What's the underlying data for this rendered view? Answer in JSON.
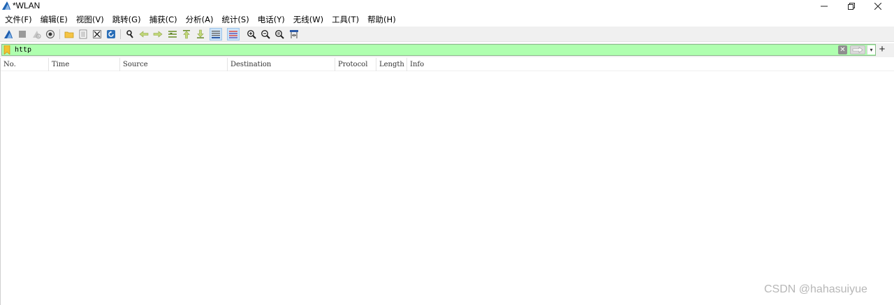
{
  "window": {
    "title": "*WLAN",
    "controls": {
      "minimize": "—",
      "maximize": "❐",
      "close": "✕"
    }
  },
  "menu": {
    "items": [
      "文件(F)",
      "编辑(E)",
      "视图(V)",
      "跳转(G)",
      "捕获(C)",
      "分析(A)",
      "统计(S)",
      "电话(Y)",
      "无线(W)",
      "工具(T)",
      "帮助(H)"
    ]
  },
  "toolbar": {
    "buttons": [
      {
        "icon": "shark-fin-start-icon",
        "active": false
      },
      {
        "icon": "stop-capture-icon",
        "active": false
      },
      {
        "icon": "restart-capture-icon",
        "active": false
      },
      {
        "icon": "capture-options-icon",
        "active": false
      },
      {
        "icon": "open-folder-icon",
        "active": false
      },
      {
        "icon": "save-file-icon",
        "active": false
      },
      {
        "icon": "close-file-icon",
        "active": false
      },
      {
        "icon": "reload-icon",
        "active": false
      },
      {
        "icon": "find-packet-icon",
        "active": false
      },
      {
        "icon": "go-back-icon",
        "active": false
      },
      {
        "icon": "go-forward-icon",
        "active": false
      },
      {
        "icon": "go-to-packet-icon",
        "active": false
      },
      {
        "icon": "go-first-icon",
        "active": false
      },
      {
        "icon": "go-last-icon",
        "active": false
      },
      {
        "icon": "auto-scroll-icon",
        "active": true
      },
      {
        "icon": "colorize-icon",
        "active": true
      },
      {
        "icon": "zoom-in-icon",
        "active": false
      },
      {
        "icon": "zoom-out-icon",
        "active": false
      },
      {
        "icon": "zoom-normal-icon",
        "active": false
      },
      {
        "icon": "resize-columns-icon",
        "active": false
      }
    ]
  },
  "filter": {
    "value": "http",
    "background": "#afffaf",
    "clear_label": "✕",
    "dropdown_label": "▾",
    "add_label": "+"
  },
  "packet_list": {
    "columns": [
      "No.",
      "Time",
      "Source",
      "Destination",
      "Protocol",
      "Length",
      "Info"
    ],
    "rows": []
  },
  "watermark": "CSDN @hahasuiyue"
}
